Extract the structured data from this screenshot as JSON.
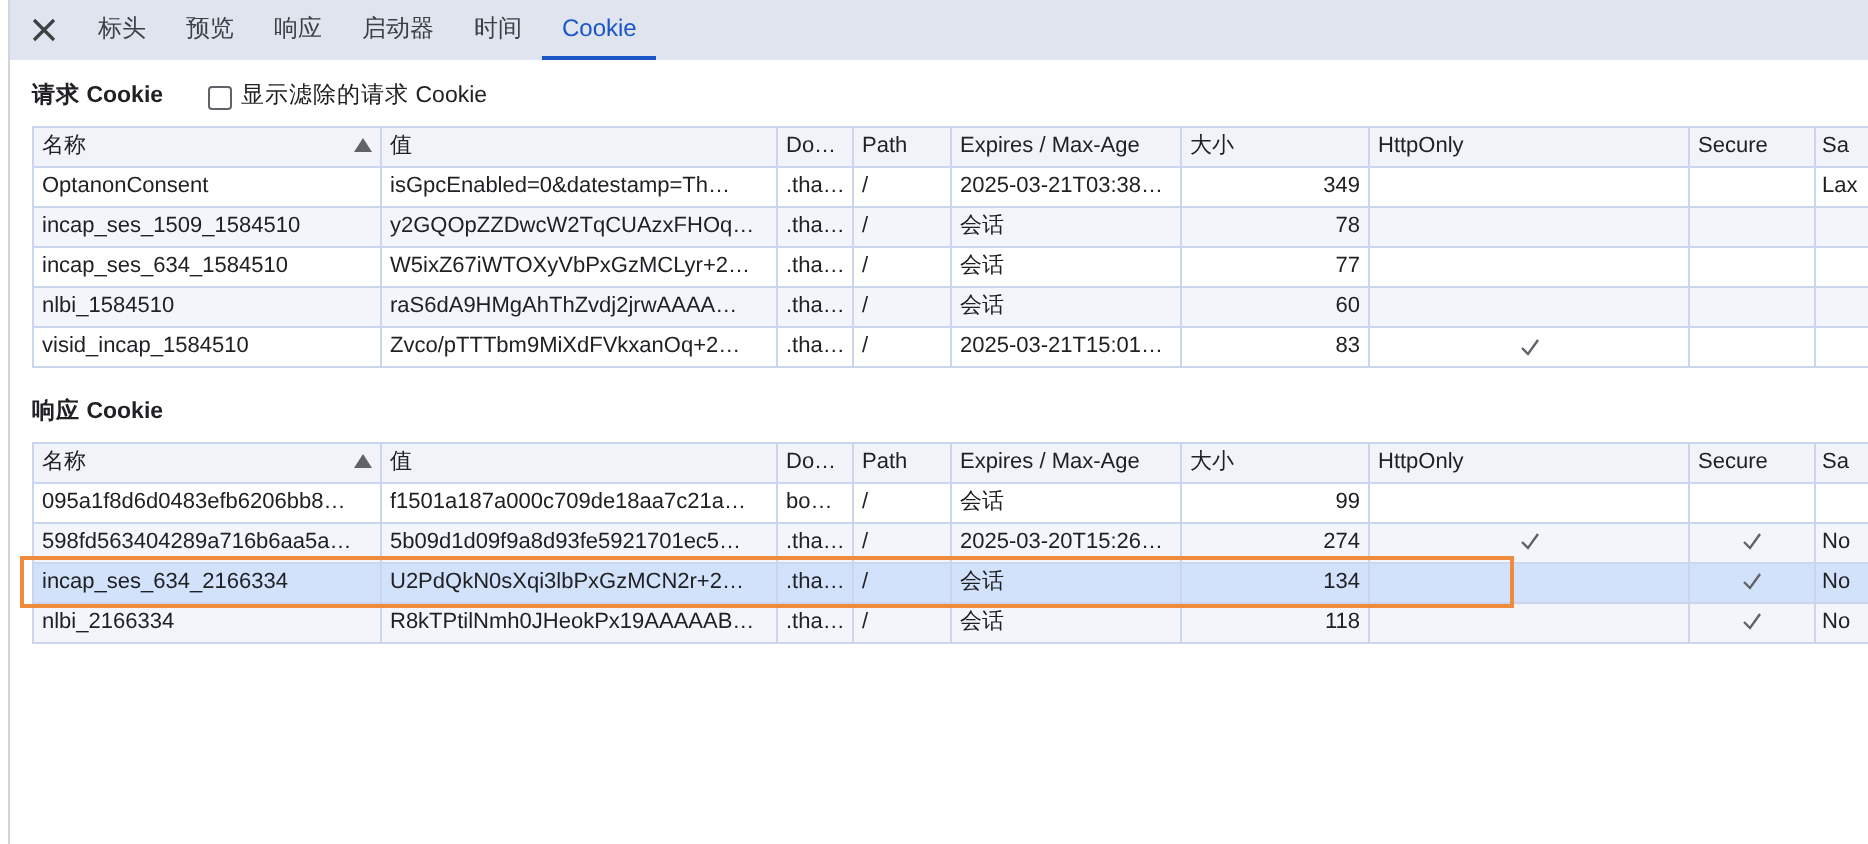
{
  "tabs": [
    {
      "label": "标头",
      "selected": false
    },
    {
      "label": "预览",
      "selected": false
    },
    {
      "label": "响应",
      "selected": false
    },
    {
      "label": "启动器",
      "selected": false
    },
    {
      "label": "时间",
      "selected": false
    },
    {
      "label": "Cookie",
      "selected": true
    }
  ],
  "request_cookies": {
    "title": "请求 Cookie",
    "show_filtered": {
      "label": "显示滤除的请求 Cookie",
      "checked": false
    },
    "columns": [
      "名称",
      "值",
      "Do…",
      "Path",
      "Expires / Max-Age",
      "大小",
      "HttpOnly",
      "Secure",
      "Sa"
    ],
    "rows": [
      {
        "name": "OptanonConsent",
        "value": "isGpcEnabled=0&datestamp=Th…",
        "domain": ".tha…",
        "path": "/",
        "expires": "2025-03-21T03:38…",
        "size": "349",
        "http_only": false,
        "secure": false,
        "same_site": "Lax",
        "selected": false,
        "annotated": false
      },
      {
        "name": "incap_ses_1509_1584510",
        "value": "y2GQOpZZDwcW2TqCUAzxFHOq…",
        "domain": ".tha…",
        "path": "/",
        "expires": "会话",
        "size": "78",
        "http_only": false,
        "secure": false,
        "selected": false,
        "annotated": false
      },
      {
        "name": "incap_ses_634_1584510",
        "value": "W5ixZ67iWTOXyVbPxGzMCLyr+2…",
        "domain": ".tha…",
        "path": "/",
        "expires": "会话",
        "size": "77",
        "http_only": false,
        "secure": false,
        "selected": false,
        "annotated": false
      },
      {
        "name": "nlbi_1584510",
        "value": "raS6dA9HMgAhThZvdj2jrwAAAA…",
        "domain": ".tha…",
        "path": "/",
        "expires": "会话",
        "size": "60",
        "http_only": false,
        "secure": false,
        "selected": false,
        "annotated": false
      },
      {
        "name": "visid_incap_1584510",
        "value": "Zvco/pTTTbm9MiXdFVkxanOq+2…",
        "domain": ".tha…",
        "path": "/",
        "expires": "2025-03-21T15:01…",
        "size": "83",
        "http_only": true,
        "secure": false,
        "selected": false,
        "annotated": false
      }
    ]
  },
  "response_cookies": {
    "title": "响应 Cookie",
    "columns": [
      "名称",
      "值",
      "Do…",
      "Path",
      "Expires / Max-Age",
      "大小",
      "HttpOnly",
      "Secure",
      "Sa"
    ],
    "rows": [
      {
        "name": "095a1f8d6d0483efb6206bb8…",
        "value": "f1501a187a000c709de18aa7c21a…",
        "domain": "bo…",
        "path": "/",
        "expires": "会话",
        "size": "99",
        "http_only": false,
        "secure": false,
        "selected": false,
        "annotated": false
      },
      {
        "name": "598fd563404289a716b6aa5a…",
        "value": "5b09d1d09f9a8d93fe5921701ec5…",
        "domain": ".tha…",
        "path": "/",
        "expires": "2025-03-20T15:26…",
        "size": "274",
        "http_only": true,
        "secure": true,
        "same_site": "No",
        "selected": false,
        "annotated": false
      },
      {
        "name": "incap_ses_634_2166334",
        "value": "U2PdQkN0sXqi3lbPxGzMCN2r+2…",
        "domain": ".tha…",
        "path": "/",
        "expires": "会话",
        "size": "134",
        "http_only": false,
        "secure": true,
        "same_site": "No",
        "selected": true,
        "annotated": true
      },
      {
        "name": "nlbi_2166334",
        "value": "R8kTPtilNmh0JHeokPx19AAAAAB…",
        "domain": ".tha…",
        "path": "/",
        "expires": "会话",
        "size": "118",
        "http_only": false,
        "secure": true,
        "same_site": "No",
        "selected": false,
        "annotated": false
      }
    ]
  }
}
